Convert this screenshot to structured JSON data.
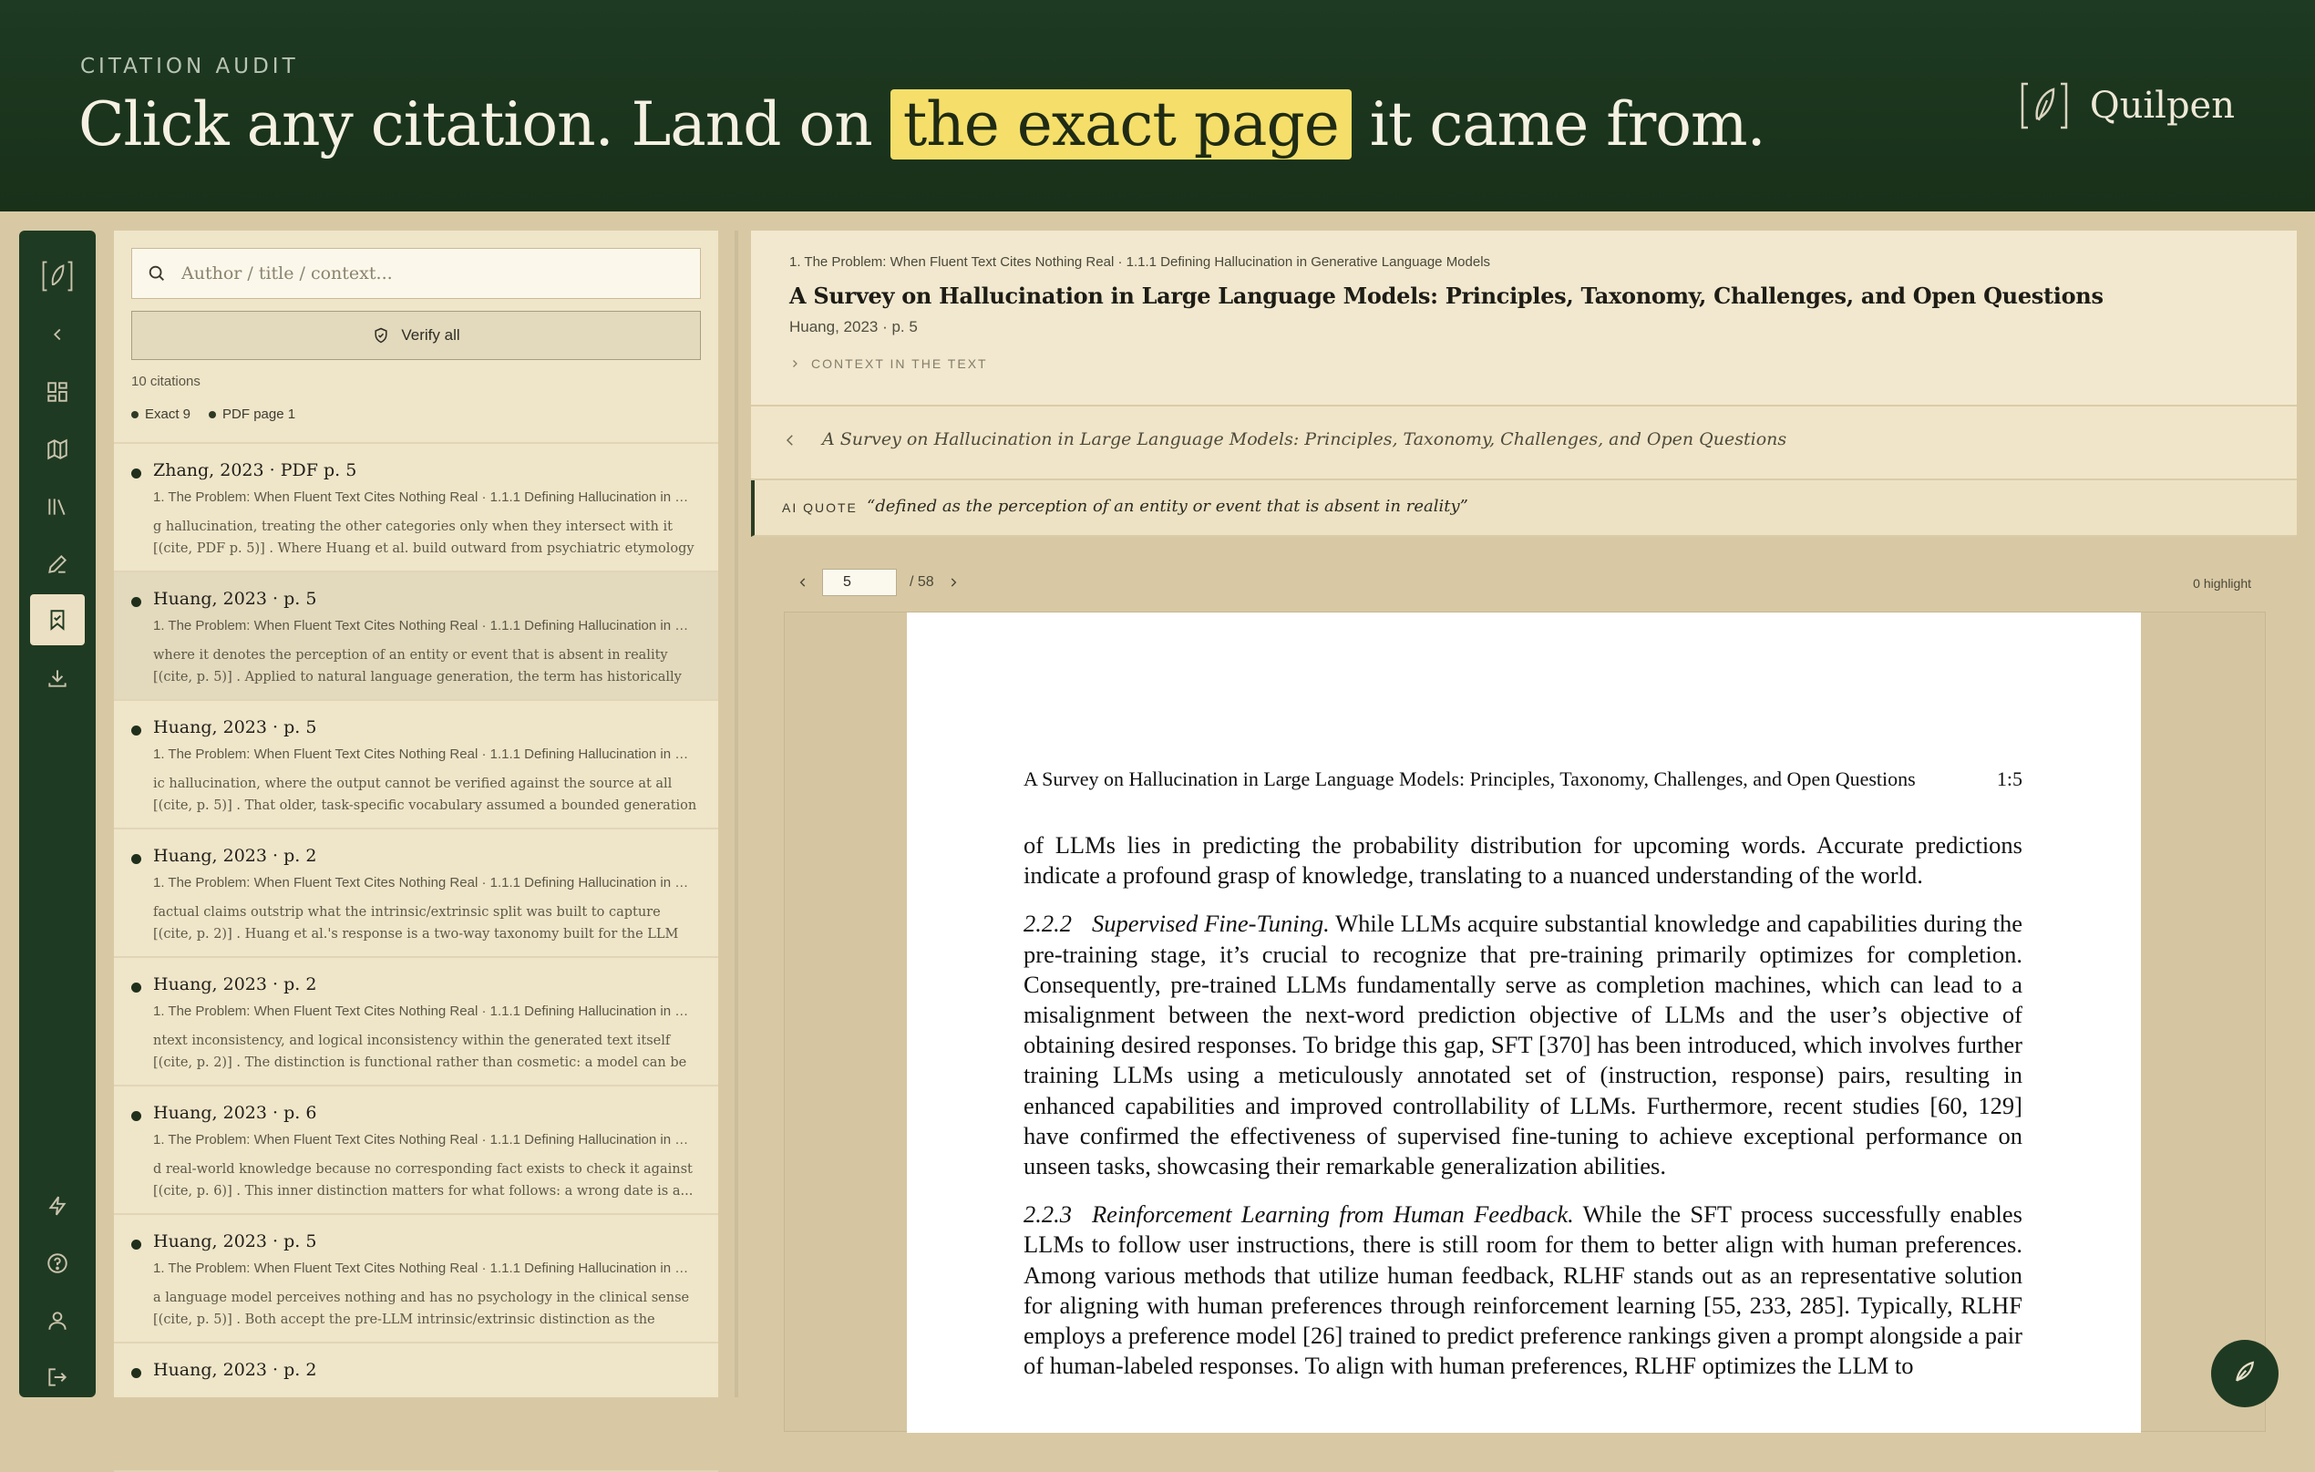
{
  "header": {
    "eyebrow": "CITATION AUDIT",
    "headline_before": "Click any citation. Land on",
    "headline_highlight": "the exact page",
    "headline_after": "it came from.",
    "brand": "Quilpen"
  },
  "rail": {
    "items": [
      {
        "icon": "quilpen-logo-icon"
      },
      {
        "icon": "chevron-left-icon"
      },
      {
        "icon": "dashboard-icon"
      },
      {
        "icon": "map-icon"
      },
      {
        "icon": "library-icon"
      },
      {
        "icon": "pen-icon"
      },
      {
        "icon": "bookmark-icon",
        "active": true
      },
      {
        "icon": "download-icon"
      },
      {
        "icon": "lightning-icon"
      },
      {
        "icon": "help-icon"
      },
      {
        "icon": "user-icon"
      },
      {
        "icon": "logout-icon"
      }
    ]
  },
  "citations_panel": {
    "search_placeholder": "Author / title / context...",
    "verify_all": "Verify all",
    "count": "10 citations",
    "legend": [
      "Exact 9",
      "PDF page 1"
    ],
    "items": [
      {
        "title": "Zhang, 2023 · PDF p. 5",
        "path": "1. The Problem: When Fluent Text Cites Nothing Real · 1.1.1 Defining Hallucination in Generative Language Models",
        "snippet": "g hallucination, treating the other categories only when they intersect with it [(cite, PDF p. 5)] . Where Huang et al. build outward from psychiatric etymology toward a..."
      },
      {
        "title": "Huang, 2023 · p. 5",
        "path": "1. The Problem: When Fluent Text Cites Nothing Real · 1.1.1 Defining Hallucination in Generative Language Models",
        "snippet": "where it denotes the perception of an entity or event that is absent in reality [(cite, p. 5)] . Applied to natural language generation, the term has historically covered any",
        "selected": true
      },
      {
        "title": "Huang, 2023 · p. 5",
        "path": "1. The Problem: When Fluent Text Cites Nothing Real · 1.1.1 Defining Hallucination in Generative Language Models",
        "snippet": "ic hallucination, where the output cannot be verified against the source at all [(cite, p. 5)] . That older, task-specific vocabulary assumed a bounded generation task with an"
      },
      {
        "title": "Huang, 2023 · p. 2",
        "path": "1. The Problem: When Fluent Text Cites Nothing Real · 1.1.1 Defining Hallucination in Generative Language Models",
        "snippet": "factual claims outstrip what the intrinsic/extrinsic split was built to capture [(cite, p. 2)] . Huang et al.'s response is a two-way taxonomy built for the LLM setting speci"
      },
      {
        "title": "Huang, 2023 · p. 2",
        "path": "1. The Problem: When Fluent Text Cites Nothing Real · 1.1.1 Defining Hallucination in Generative Language Models",
        "snippet": "ntext inconsistency, and logical inconsistency within the generated text itself [(cite, p. 2)] . The distinction is functional rather than cosmetic: a model can be internally"
      },
      {
        "title": "Huang, 2023 · p. 6",
        "path": "1. The Problem: When Fluent Text Cites Nothing Real · 1.1.1 Defining Hallucination in Generative Language Models",
        "snippet": "d real-world knowledge because no corresponding fact exists to check it against [(cite, p. 6)] . This inner distinction matters for what follows: a wrong date is a..."
      },
      {
        "title": "Huang, 2023 · p. 5",
        "path": "1. The Problem: When Fluent Text Cites Nothing Real · 1.1.1 Defining Hallucination in Generative Language Models",
        "snippet": "a language model perceives nothing and has no psychology in the clinical sense [(cite, p. 5)] . Both accept the pre-LLM intrinsic/extrinsic distinction as the historical base"
      },
      {
        "title": "Huang, 2023 · p. 2",
        "path": "",
        "snippet": ""
      }
    ]
  },
  "detail": {
    "breadcrumb": "1. The Problem: When Fluent Text Cites Nothing Real · 1.1.1 Defining Hallucination in Generative Language Models",
    "title": "A Survey on Hallucination in Large Language Models: Principles, Taxonomy, Challenges, and Open Questions",
    "meta": "Huang, 2023 · p. 5",
    "context_toggle": "CONTEXT IN THE TEXT",
    "source_title": "A Survey on Hallucination in Large Language Models: Principles, Taxonomy, Challenges, and Open Questions",
    "ai_quote_label": "AI QUOTE",
    "ai_quote": "“defined as the perception of an entity or event that is absent in reality”",
    "page_current": "5",
    "page_total": "/ 58",
    "highlight_count": "0 highlight"
  },
  "pdf": {
    "running_head": "A Survey on Hallucination in Large Language Models: Principles, Taxonomy, Challenges, and Open Questions",
    "running_page": "1:5",
    "para1": "of LLMs lies in predicting the probability distribution for upcoming words. Accurate predictions indicate a profound grasp of knowledge, translating to a nuanced understanding of the world.",
    "sec1_num": "2.2.2",
    "sec1_title": "Supervised Fine-Tuning.",
    "para2": "While LLMs acquire substantial knowledge and capabilities during the pre-training stage, it’s crucial to recognize that pre-training primarily optimizes for completion. Consequently, pre-trained LLMs fundamentally serve as completion machines, which can lead to a misalignment between the next-word prediction objective of LLMs and the user’s objective of obtaining desired responses. To bridge this gap, SFT [370] has been introduced, which involves further training LLMs using a meticulously annotated set of (instruction, response) pairs, resulting in enhanced capabilities and improved controllability of LLMs. Furthermore, recent studies [60, 129] have confirmed the effectiveness of supervised fine-tuning to achieve exceptional performance on unseen tasks, showcasing their remarkable generalization abilities.",
    "sec2_num": "2.2.3",
    "sec2_title": "Reinforcement Learning from Human Feedback.",
    "para3": "While the SFT process successfully enables LLMs to follow user instructions, there is still room for them to better align with human preferences. Among various methods that utilize human feedback, RLHF stands out as an representative solution for aligning with human preferences through reinforcement learning [55, 233, 285]. Typically, RLHF employs a preference model [26] trained to predict preference rankings given a prompt alongside a pair of human-labeled responses. To align with human preferences, RLHF optimizes the LLM to"
  },
  "colors": {
    "header_bg": "#1e3a22",
    "highlight": "#f5df6a",
    "panel_bg": "#efe5c9",
    "accent_dark": "#1f3a22"
  }
}
